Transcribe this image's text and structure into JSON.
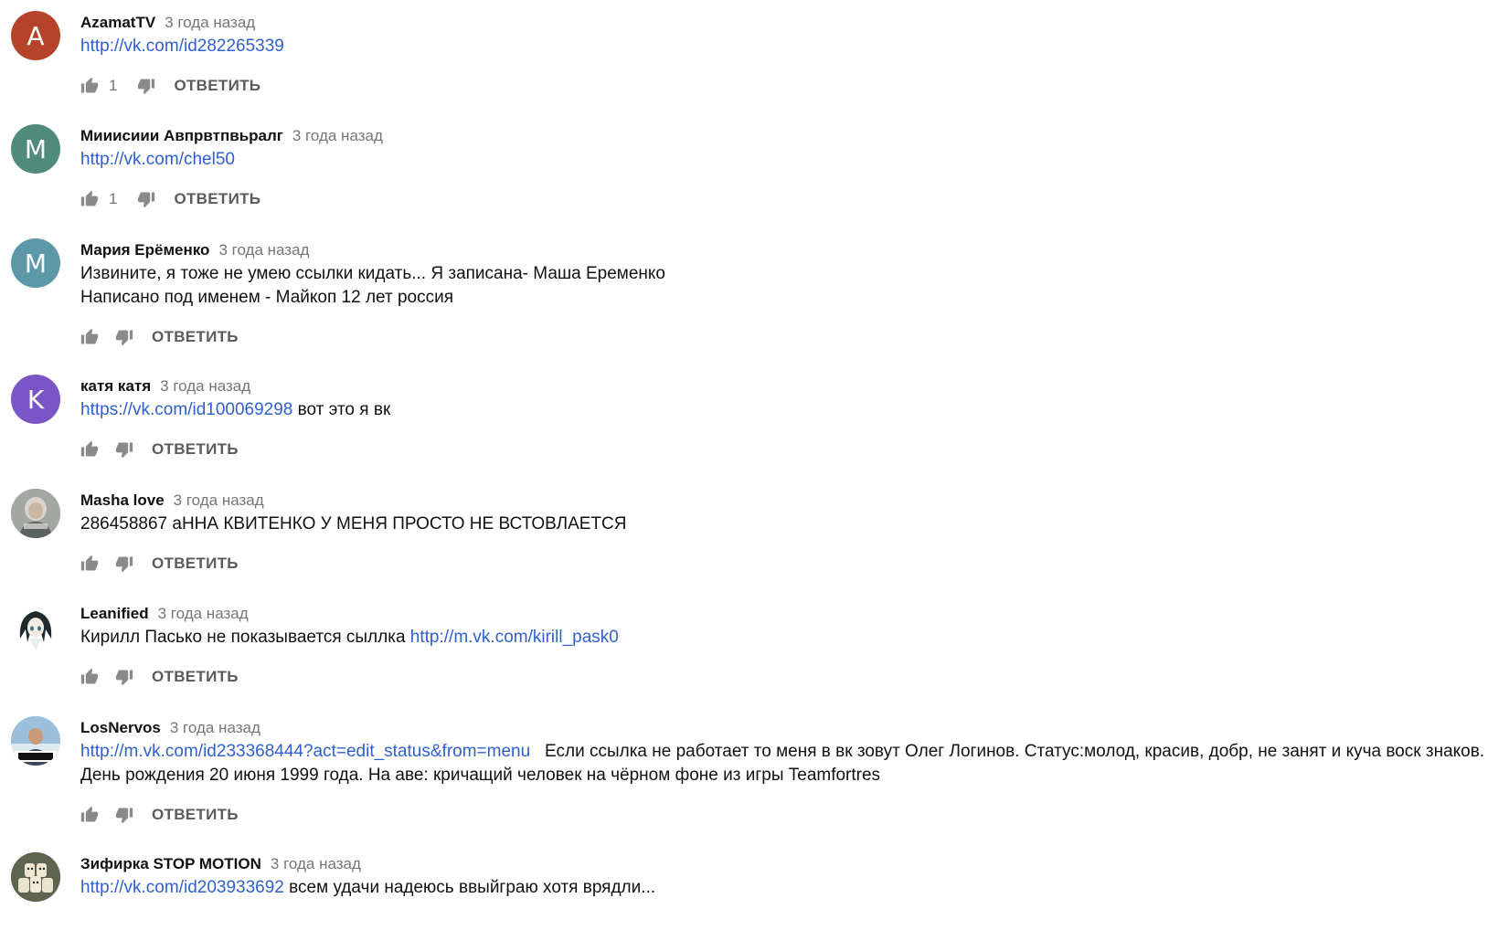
{
  "comments": [
    {
      "author": "AzamatTV",
      "time": "3 года назад",
      "avatar": {
        "type": "letter",
        "letter": "A",
        "color": "#b5432a"
      },
      "link": "http://vk.com/id282265339",
      "text_after": "",
      "text_lines": [],
      "likes": "1",
      "reply_label": "ОТВЕТИТЬ"
    },
    {
      "author": "Мииисиии Авпрвтпвьралг",
      "time": "3 года назад",
      "avatar": {
        "type": "letter",
        "letter": "M",
        "color": "#4f8a7a"
      },
      "link": "http://vk.com/chel50",
      "text_after": "",
      "text_lines": [],
      "likes": "1",
      "reply_label": "ОТВЕТИТЬ"
    },
    {
      "author": "Мария Ерёменко",
      "time": "3 года назад",
      "avatar": {
        "type": "letter",
        "letter": "M",
        "color": "#5d98a8"
      },
      "link": "",
      "text_after": "",
      "text_lines": [
        "Извините, я тоже не умею ссылки кидать... Я записана- Маша Еременко",
        "Написано под именем - Майкоп 12 лет россия"
      ],
      "likes": "",
      "reply_label": "ОТВЕТИТЬ"
    },
    {
      "author": "катя катя",
      "time": "3 года назад",
      "avatar": {
        "type": "letter",
        "letter": "K",
        "color": "#7a55c6"
      },
      "link": "https://vk.com/id100069298",
      "text_after": " вот это я вк",
      "text_lines": [],
      "likes": "",
      "reply_label": "ОТВЕТИТЬ"
    },
    {
      "author": "Masha love",
      "time": "3 года назад",
      "avatar": {
        "type": "image",
        "icon": "photo-avatar-icon"
      },
      "link": "",
      "text_after": "",
      "text_lines": [
        "286458867 аННА КВИТЕНКО У МЕНЯ ПРОСТО НЕ ВСТОВЛАЕТСЯ"
      ],
      "likes": "",
      "reply_label": "ОТВЕТИТЬ"
    },
    {
      "author": "Leanified",
      "time": "3 года назад",
      "avatar": {
        "type": "image",
        "icon": "anime-girl-avatar-icon"
      },
      "link": "",
      "text_before": "Кирилл Пасько не показывается сыллка ",
      "link_inline": "http://m.vk.com/kirill_pask0",
      "text_lines": [],
      "likes": "",
      "reply_label": "ОТВЕТИТЬ"
    },
    {
      "author": "LosNervos",
      "time": "3 года назад",
      "avatar": {
        "type": "image",
        "icon": "gta-avatar-icon"
      },
      "link": "http://m.vk.com/id233368444?act=edit_status&from=menu",
      "text_after": "   Если ссылка не работает то меня в вк зовут Олег Логинов. Статус:молод, красив, добр, не занят и куча воск знаков.",
      "text_lines": [
        "День рождения 20 июня 1999 года. На аве: кричащий человек на чёрном фоне из игры Teamfortres"
      ],
      "likes": "",
      "reply_label": "ОТВЕТИТЬ"
    },
    {
      "author": "Зифирка STOP MOTION",
      "time": "3 года назад",
      "avatar": {
        "type": "image",
        "icon": "marshmallow-avatar-icon"
      },
      "link": "http://vk.com/id203933692",
      "text_after": " всем удачи надеюсь ввыйграю хотя врядли...",
      "text_lines": [],
      "likes": "",
      "reply_label": "ОТВЕТИТЬ"
    }
  ]
}
